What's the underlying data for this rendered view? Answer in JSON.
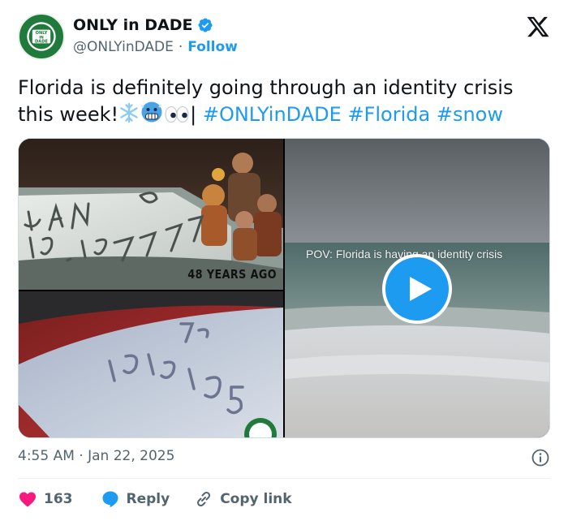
{
  "author": {
    "display_name": "ONLY in DADE",
    "handle": "@ONLYinDADE",
    "separator": "·",
    "follow_label": "Follow",
    "verified": true,
    "avatar_text": [
      "ONLY",
      "IN",
      "DADE"
    ]
  },
  "tweet": {
    "text_line1": "Florida is definitely going through an identity crisis",
    "text_line2_prefix": "this week!",
    "emoji_after_text": [
      "snowflake",
      "cold-face",
      "eyes"
    ],
    "pipe": "|",
    "hashtags": [
      "#ONLYinDADE",
      "#Florida",
      "#snow"
    ]
  },
  "media": {
    "overlay_years": "48 YEARS AGO",
    "video_caption": "POV: Florida is having an identity crisis",
    "snow_writing_top": "JAN 19, 1977",
    "snow_writing_bottom": "1.21.25"
  },
  "meta": {
    "timestamp": "4:55 AM · Jan 22, 2025"
  },
  "actions": {
    "like_count": "163",
    "reply_label": "Reply",
    "copy_link_label": "Copy link"
  },
  "colors": {
    "accent": "#1d9bf0",
    "like": "#f91880",
    "text": "#0f1419",
    "secondary": "#536471"
  }
}
